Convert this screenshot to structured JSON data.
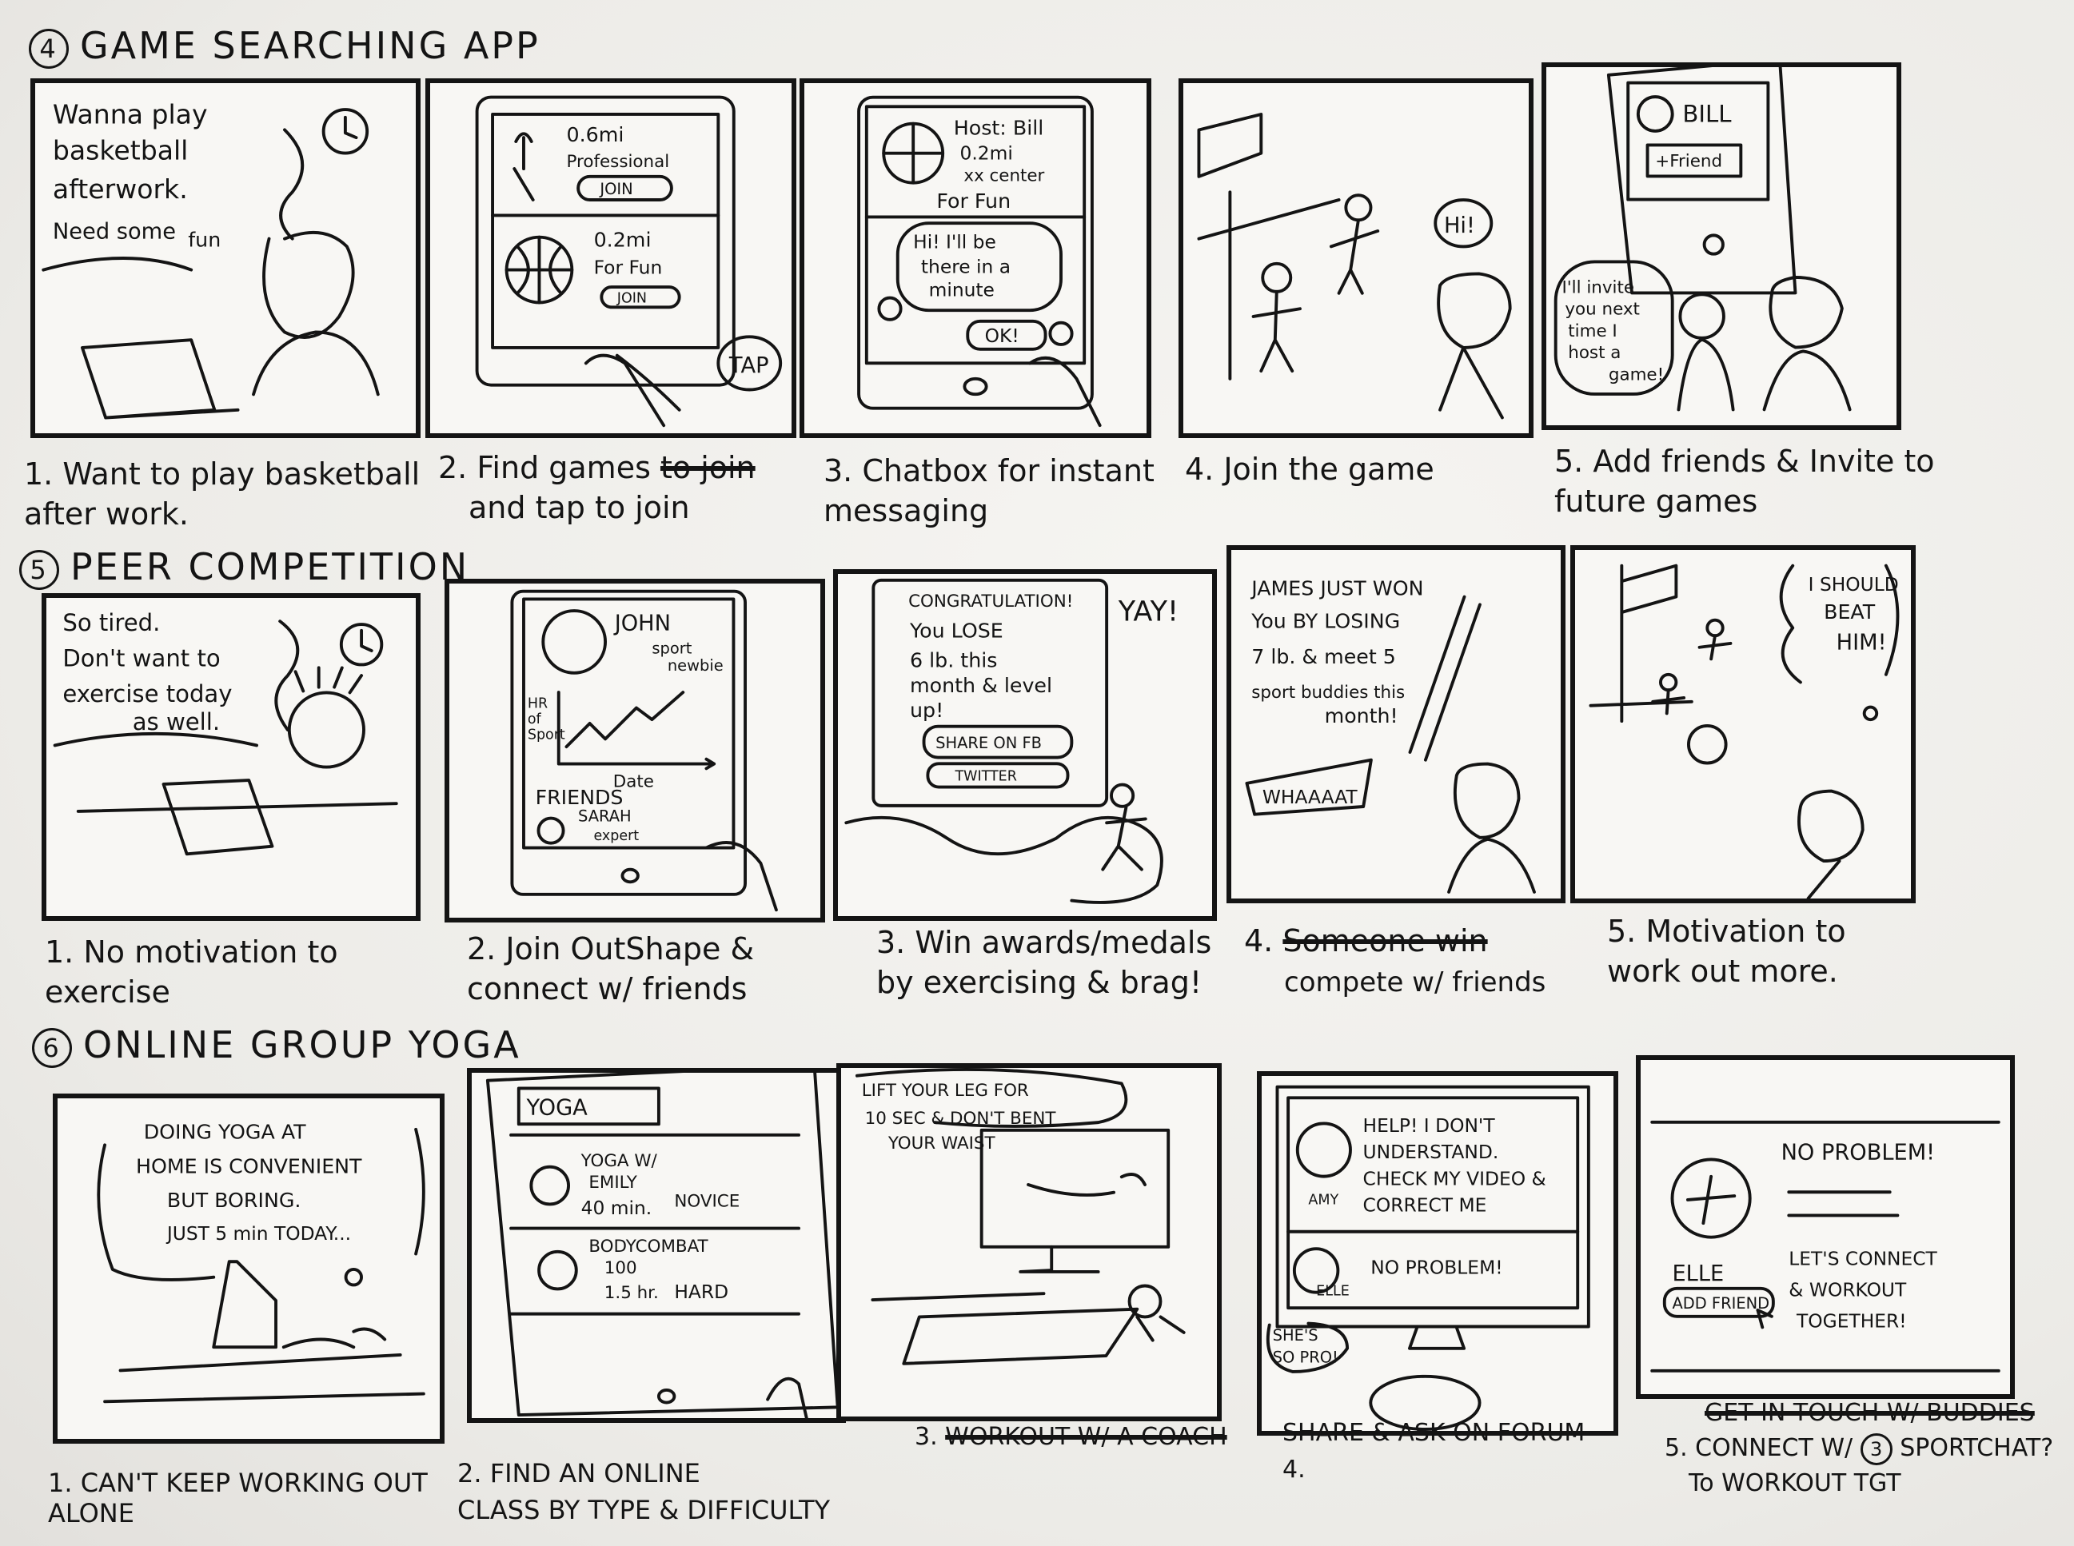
{
  "sections": [
    {
      "number": "4",
      "title": "GAME SEARCHING APP",
      "panels": [
        {
          "texts": [
            "Wanna play",
            "basketball",
            "afterwork.",
            "Need some",
            "fun"
          ]
        },
        {
          "texts": [
            "0.6mi",
            "Professional",
            "JOIN",
            "0.2mi",
            "For Fun",
            "JOIN",
            "TAP"
          ]
        },
        {
          "texts": [
            "Host: Bill",
            "0.2mi",
            "xx center",
            "For Fun",
            "Hi! I'll be",
            "there in a",
            "minute",
            "OK!"
          ]
        },
        {
          "texts": [
            "Hi!"
          ]
        },
        {
          "texts": [
            "BILL",
            "+Friend",
            "I'll invite",
            "you next",
            "time I",
            "host a",
            "game!"
          ]
        }
      ],
      "captions": [
        "1. Want to play basketball\n    after work.",
        "2. Find games",
        "3. Chatbox for instant\n    messaging",
        "4. Join the game",
        "5. Add friends & Invite to\n    future games"
      ],
      "caption2_strike": "to join",
      "caption2_rest": "and tap to join"
    },
    {
      "number": "5",
      "title": "PEER COMPETITION",
      "panels": [
        {
          "texts": [
            "So tired.",
            "Don't want to",
            "exercise today",
            "as well."
          ]
        },
        {
          "texts": [
            "JOHN",
            "sport",
            "newbie",
            "HR",
            "of",
            "Sport",
            "Date",
            "FRIENDS",
            "SARAH",
            "expert"
          ]
        },
        {
          "texts": [
            "CONGRATULATION!",
            "You LOSE",
            "6 lb. this",
            "month & level",
            "up!",
            "SHARE ON FB",
            "TWITTER",
            "YAY!"
          ]
        },
        {
          "texts": [
            "JAMES JUST WON",
            "You BY LOSING",
            "7 lb. & meet 5",
            "sport buddies this",
            "month!",
            "WHAAAAT"
          ]
        },
        {
          "texts": [
            "I SHOULD",
            "BEAT",
            "HIM!"
          ]
        }
      ],
      "captions": [
        "1. No motivation to\n    exercise",
        "2. Join OutShape &\n    connect w/ friends",
        "3. Win awards/medals\n    by exercising & brag!",
        "4.",
        "5. Motivation to\n    work out more."
      ],
      "caption4_strike": "Someone win",
      "caption4_rest": "compete w/ friends"
    },
    {
      "number": "6",
      "title": "ONLINE GROUP YOGA",
      "panels": [
        {
          "texts": [
            "DOING YOGA AT",
            "HOME IS CONVENIENT",
            "BUT BORING.",
            "JUST 5 min TODAY..."
          ]
        },
        {
          "texts": [
            "YOGA",
            "YOGA W/",
            "EMILY",
            "40 min.",
            "NOVICE",
            "BODYCOMBAT",
            "100",
            "1.5 hr.",
            "HARD"
          ]
        },
        {
          "texts": [
            "LIFT YOUR LEG FOR",
            "10 SEC & DON'T BENT",
            "YOUR WAIST"
          ]
        },
        {
          "texts": [
            "HELP! I DON'T",
            "UNDERSTAND.",
            "CHECK MY VIDEO &",
            "CORRECT ME",
            "AMY",
            "NO PROBLEM!",
            "ELLE",
            "SHE'S",
            "SO PRO!"
          ]
        },
        {
          "texts": [
            "NO PROBLEM!",
            "ELLE",
            "ADD FRIEND",
            "LET'S CONNECT",
            "& WORKOUT",
            "TOGETHER!"
          ]
        }
      ],
      "captions": [
        "1. CAN'T KEEP WORKING OUT\n    ALONE",
        "2. FIND AN ONLINE\n    CLASS BY TYPE & DIFFICULTY",
        "WORKOUT W/ A COACH",
        "SHARE & ASK ON FORUM",
        "5. CONNECT W/"
      ],
      "caption5_top_strike": "GET IN TOUCH W/ BUDDIES",
      "caption5_tail": "SPORTCHAT?",
      "caption5_circle": "3",
      "caption5_line2": "To WORKOUT TGT",
      "caption3_num": "3.",
      "caption4_num": "4."
    }
  ]
}
